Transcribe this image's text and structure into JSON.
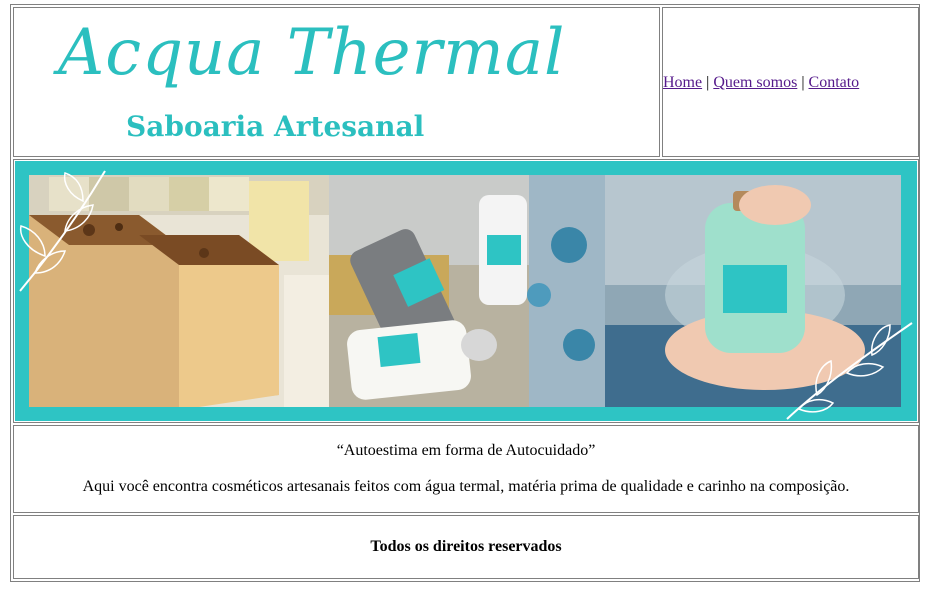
{
  "header": {
    "logo_script": "Acqua Thermal",
    "logo_sub": "Saboaria Artesanal"
  },
  "nav": {
    "links": [
      "Home",
      "Quem somos",
      "Contato"
    ],
    "separator": "|"
  },
  "banner": {
    "photo_1": "artisan-soap-bars",
    "photo_2": "cosmetic-tubes-and-flowers",
    "photo_3": "bath-salt-jar",
    "frame_color": "#2ec4c4"
  },
  "content": {
    "quote": "“Autoestima em forma de Autocuidado”",
    "description": "Aqui você encontra cosméticos artesanais feitos com água termal, matéria prima de qualidade e carinho na composição."
  },
  "footer": {
    "text": "Todos os direitos reservados"
  },
  "colors": {
    "brand": "#2bbfbf",
    "link": "#551a8b",
    "border": "#808080"
  }
}
